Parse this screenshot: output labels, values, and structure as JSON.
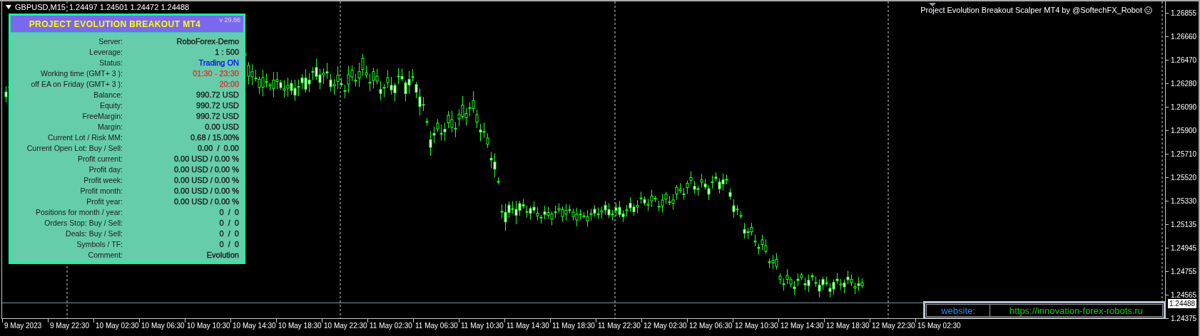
{
  "chart_header": {
    "symbol": "GBPUSD,M15",
    "quotes": "1.24497 1.24501 1.24472 1.24488"
  },
  "indicator_title": "Project Evolution Breakout Scalper MT4 by @SoftechFX_Robot",
  "info_panel": {
    "title": "PROJECT EVOLUTION BREAKOUT MT4",
    "version": "v 29.86",
    "rows": [
      {
        "label": "Server:",
        "value": "RoboForex-Demo",
        "color": "#1a1a1a"
      },
      {
        "label": "Leverage:",
        "value": "1 : 500",
        "color": "#1a1a1a"
      },
      {
        "label": "Status:",
        "value": "Trading ON",
        "color": "#1010f0"
      },
      {
        "label": "Working time (GMT+ 3 ):",
        "value": "01:30 - 23:30",
        "color": "#e0302a"
      },
      {
        "label": "off EA on Friday (GMT+ 3 ):",
        "value": "20:00",
        "color": "#e0302a"
      },
      {
        "label": "Balance:",
        "value": "990.72 USD",
        "color": "#1a1a1a"
      },
      {
        "label": "Equity:",
        "value": "990.72 USD",
        "color": "#1a1a1a"
      },
      {
        "label": "FreeMargin:",
        "value": "990.72 USD",
        "color": "#1a1a1a"
      },
      {
        "label": "Margin:",
        "value": "0.00 USD",
        "color": "#1a1a1a"
      },
      {
        "label": "Current Lot / Risk MM:",
        "value": "0.68 / 15.00%",
        "color": "#1a1a1a"
      },
      {
        "label": "Current Open Lot: Buy / Sell:",
        "value": "0.00  /  0.00",
        "color": "#1a1a1a"
      },
      {
        "label": "Profit current:",
        "value": "0.00 USD / 0.00 %",
        "color": "#1a1a1a"
      },
      {
        "label": "Profit day:",
        "value": "0.00 USD / 0.00 %",
        "color": "#1a1a1a"
      },
      {
        "label": "Profit week:",
        "value": "0.00 USD / 0.00 %",
        "color": "#1a1a1a"
      },
      {
        "label": "Profit month:",
        "value": "0.00 USD / 0.00 %",
        "color": "#1a1a1a"
      },
      {
        "label": "Profit year:",
        "value": "0.00 USD / 0.00 %",
        "color": "#1a1a1a"
      },
      {
        "label": "Positions for month / year:",
        "value": "0  /  0",
        "color": "#1a1a1a"
      },
      {
        "label": "Orders Stop: Buy / Sell:",
        "value": "0  /  0",
        "color": "#1a1a1a"
      },
      {
        "label": "Deals: Buy / Sell:",
        "value": "0  /  0",
        "color": "#1a1a1a"
      },
      {
        "label": "Symbols / TF:",
        "value": "0  /  0",
        "color": "#1a1a1a"
      },
      {
        "label": "Comment:",
        "value": "Evolution",
        "color": "#1a1a1a"
      }
    ]
  },
  "website_box": {
    "label": "website:",
    "url": "https://innovation-forex-robots.ru"
  },
  "price_axis": {
    "labels": [
      "1.26855",
      "1.26660",
      "1.26470",
      "1.26280",
      "1.26090",
      "1.25900",
      "1.25710",
      "1.25520",
      "1.25330",
      "1.25135",
      "1.24945",
      "1.24755",
      "1.24565",
      "1.24375"
    ],
    "current_price": "1.24488"
  },
  "time_axis": {
    "labels": [
      "9 May 2023",
      "9 May 22:30",
      "10 May 02:30",
      "10 May 06:30",
      "10 May 10:30",
      "10 May 14:30",
      "10 May 18:30",
      "10 May 22:30",
      "11 May 02:30",
      "11 May 06:30",
      "11 May 10:30",
      "11 May 14:30",
      "11 May 18:30",
      "11 May 22:30",
      "12 May 02:30",
      "12 May 06:30",
      "12 May 10:30",
      "12 May 14:30",
      "12 May 18:30",
      "12 May 22:30",
      "15 May 02:30"
    ]
  }
}
